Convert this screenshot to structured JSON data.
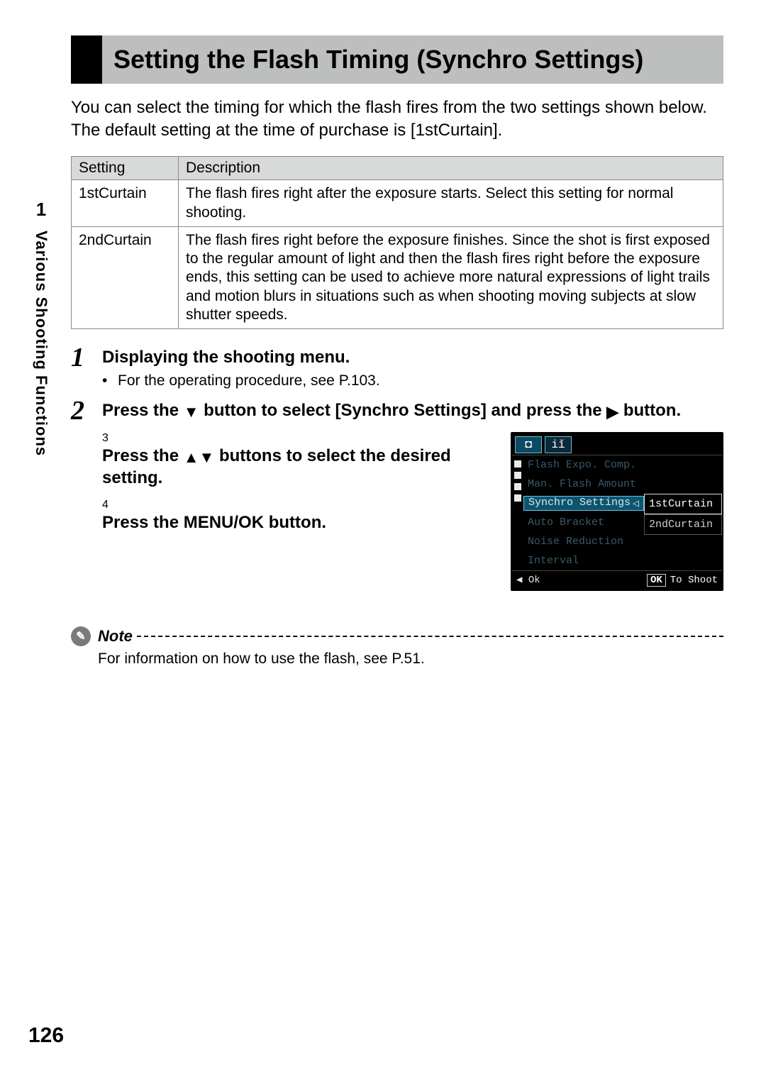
{
  "side": {
    "chapter_number": "1",
    "chapter_title": "Various Shooting Functions"
  },
  "page_number": "126",
  "title": "Setting the Flash Timing (Synchro Settings)",
  "intro": "You can select the timing for which the flash fires from the two settings shown below. The default setting at the time of purchase is [1stCurtain].",
  "table": {
    "headers": {
      "setting": "Setting",
      "description": "Description"
    },
    "rows": [
      {
        "setting": "1stCurtain",
        "description": "The flash fires right after the exposure starts. Select this setting for normal shooting."
      },
      {
        "setting": "2ndCurtain",
        "description": "The flash fires right before the exposure finishes. Since the shot is first exposed to the regular amount of light and then the flash fires right before the exposure ends, this setting can be used to achieve more natural expressions of light trails and motion blurs in situations such as when shooting moving subjects at slow shutter speeds."
      }
    ]
  },
  "steps": [
    {
      "n": "1",
      "head": "Displaying the shooting menu.",
      "sub": "For the operating procedure, see P.103."
    },
    {
      "n": "2",
      "head_parts": {
        "a": "Press the ",
        "b": " button to select [Synchro Settings] and press the ",
        "c": " button."
      }
    },
    {
      "n": "3",
      "head_parts": {
        "a": "Press the ",
        "b": " buttons to select the desired setting."
      }
    },
    {
      "n": "4",
      "head": "Press the MENU/OK button."
    }
  ],
  "lcd": {
    "menu_items": [
      "Flash Expo. Comp.",
      "Man. Flash Amount",
      "Synchro Settings",
      "Auto Bracket",
      "Noise Reduction",
      "Interval"
    ],
    "selected_index": 2,
    "options": [
      "1stCurtain",
      "2ndCurtain"
    ],
    "option_selected_index": 0,
    "footer_left": "◀ Ok",
    "footer_ok": "OK",
    "footer_right": "To Shoot"
  },
  "note": {
    "label": "Note",
    "body": "For information on how to use the flash, see P.51."
  },
  "glyphs": {
    "down": "▼",
    "right": "▶",
    "up_down": "▲▼",
    "arrow_indicator": "◁"
  }
}
